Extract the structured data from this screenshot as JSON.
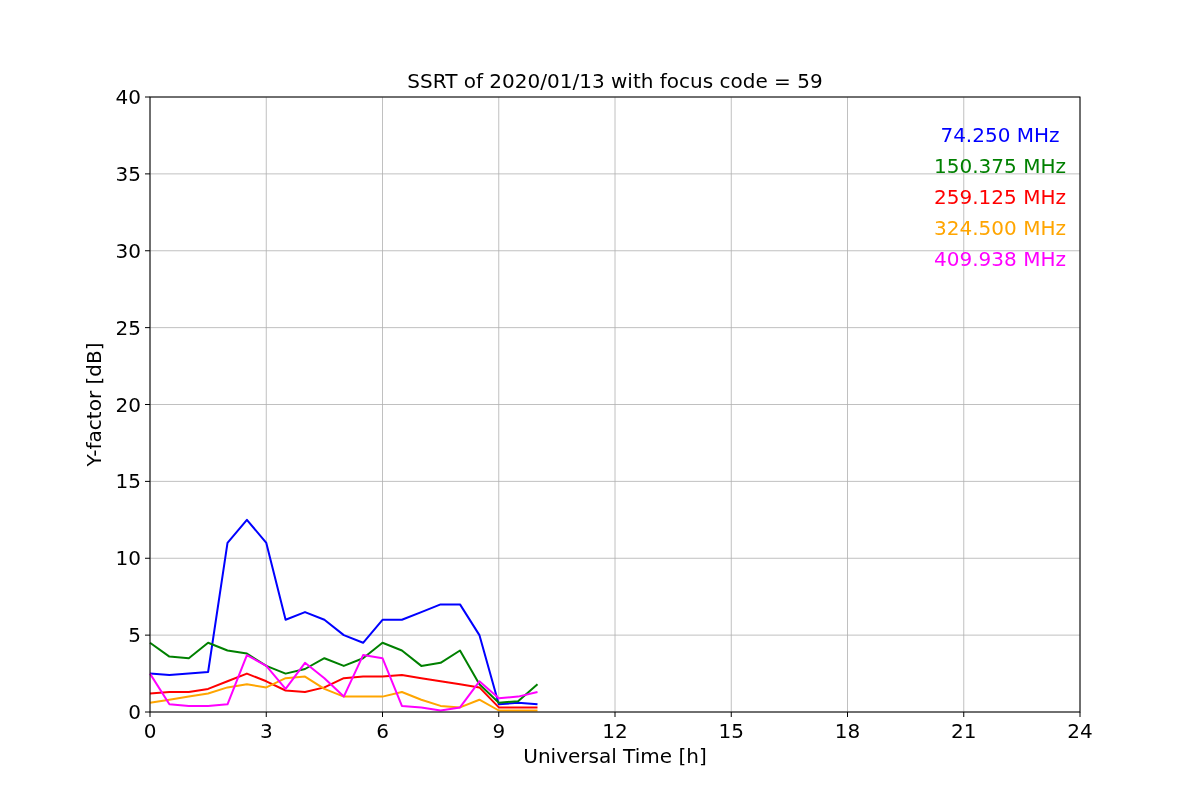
{
  "chart_data": {
    "type": "line",
    "title": "SSRT of 2020/01/13 with focus code = 59",
    "xlabel": "Universal Time [h]",
    "ylabel": "Y-factor [dB]",
    "x": [
      0,
      0.5,
      1,
      1.5,
      2,
      2.5,
      3,
      3.5,
      4,
      4.5,
      5,
      5.5,
      6,
      6.5,
      7,
      7.5,
      8,
      8.5,
      9,
      9.5,
      10
    ],
    "series": [
      {
        "name": "74.250 MHz",
        "color": "#0000ff",
        "values": [
          2.5,
          2.4,
          2.5,
          2.6,
          11,
          12.5,
          11,
          6,
          6.5,
          6,
          5,
          4.5,
          6,
          6,
          6.5,
          7,
          7,
          5,
          0.5,
          0.6,
          0.5
        ]
      },
      {
        "name": "150.375 MHz",
        "color": "#008000",
        "values": [
          4.5,
          3.6,
          3.5,
          4.5,
          4,
          3.8,
          3,
          2.5,
          2.8,
          3.5,
          3,
          3.5,
          4.5,
          4,
          3,
          3.2,
          4,
          1.8,
          0.6,
          0.7,
          1.8
        ]
      },
      {
        "name": "259.125 MHz",
        "color": "#ff0000",
        "values": [
          1.2,
          1.3,
          1.3,
          1.5,
          2,
          2.5,
          2,
          1.4,
          1.3,
          1.6,
          2.2,
          2.3,
          2.3,
          2.4,
          2.2,
          2,
          1.8,
          1.6,
          0.3,
          0.3,
          0.3
        ]
      },
      {
        "name": "324.500 MHz",
        "color": "#ffa500",
        "values": [
          0.6,
          0.8,
          1,
          1.2,
          1.6,
          1.8,
          1.6,
          2.2,
          2.3,
          1.5,
          1,
          1,
          1,
          1.3,
          0.8,
          0.4,
          0.3,
          0.8,
          0.1,
          0.1,
          0.1
        ]
      },
      {
        "name": "409.938 MHz",
        "color": "#ff00ff",
        "values": [
          2.5,
          0.5,
          0.4,
          0.4,
          0.5,
          3.7,
          3,
          1.5,
          3.2,
          2.2,
          1,
          3.7,
          3.5,
          0.4,
          0.3,
          0.1,
          0.3,
          2,
          0.9,
          1,
          1.3
        ]
      }
    ],
    "grid": true,
    "xlim": [
      0,
      24
    ],
    "ylim": [
      0,
      40
    ],
    "xticks": [
      0,
      3,
      6,
      9,
      12,
      15,
      18,
      21,
      24
    ],
    "yticks": [
      0,
      5,
      10,
      15,
      20,
      25,
      30,
      35,
      40
    ]
  }
}
